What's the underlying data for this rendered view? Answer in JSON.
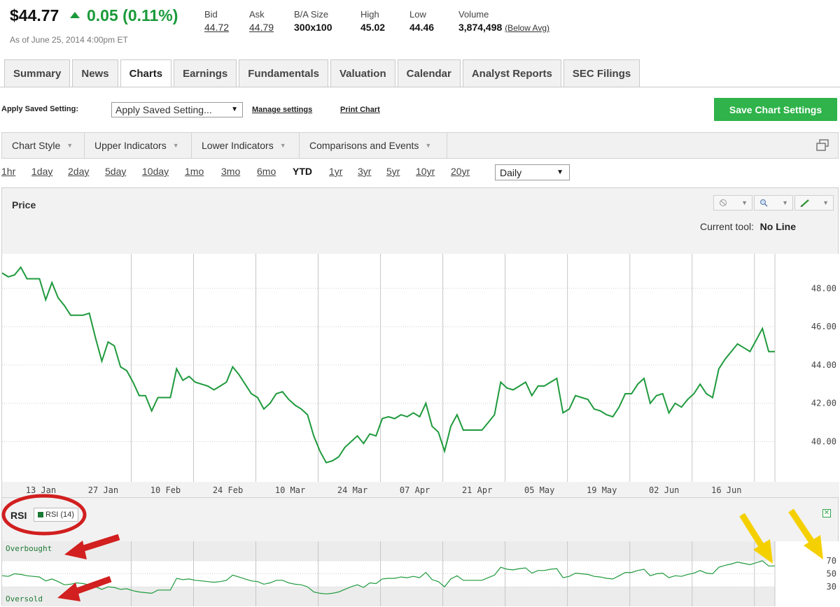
{
  "quote": {
    "price": "$44.77",
    "change": "0.05 (0.11%)",
    "as_of": "As of June 25, 2014 4:00pm ET",
    "stats": [
      {
        "label": "Bid",
        "value": "44.72",
        "style": "link"
      },
      {
        "label": "Ask",
        "value": "44.79",
        "style": "link"
      },
      {
        "label": "B/A Size",
        "value": "300x100",
        "style": "bold"
      },
      {
        "label": "High",
        "value": "45.02",
        "style": "bold"
      },
      {
        "label": "Low",
        "value": "44.46",
        "style": "bold"
      },
      {
        "label": "Volume",
        "value": "3,874,498",
        "style": "bold"
      }
    ],
    "volume_note": "(Below Avg)",
    "up_color": "#1a9a3a"
  },
  "tabs": [
    {
      "label": "Summary",
      "active": false
    },
    {
      "label": "News",
      "active": false
    },
    {
      "label": "Charts",
      "active": true
    },
    {
      "label": "Earnings",
      "active": false
    },
    {
      "label": "Fundamentals",
      "active": false
    },
    {
      "label": "Valuation",
      "active": false
    },
    {
      "label": "Calendar",
      "active": false
    },
    {
      "label": "Analyst Reports",
      "active": false
    },
    {
      "label": "SEC Filings",
      "active": false
    }
  ],
  "settings": {
    "apply_label": "Apply Saved Setting:",
    "apply_value": "Apply Saved Setting...",
    "manage": "Manage settings",
    "print": "Print Chart",
    "save_button": "Save Chart Settings",
    "save_color": "#2fb34a"
  },
  "toolbar": [
    "Chart Style",
    "Upper Indicators",
    "Lower Indicators",
    "Comparisons and Events"
  ],
  "periods": {
    "items": [
      "1hr",
      "1day",
      "2day",
      "5day",
      "10day",
      "1mo",
      "3mo",
      "6mo",
      "YTD",
      "1yr",
      "3yr",
      "5yr",
      "10yr",
      "20yr"
    ],
    "active": "YTD",
    "interval": "Daily"
  },
  "price_panel": {
    "title": "Price",
    "current_tool_label": "Current tool:",
    "current_tool_value": "No Line"
  },
  "rsi_panel": {
    "title": "RSI",
    "legend": "RSI (14)",
    "overbought": "Overbought",
    "oversold": "Oversold"
  },
  "chart_data": [
    {
      "type": "line",
      "title": "Price",
      "x_ticks": [
        "13 Jan",
        "27 Jan",
        "10 Feb",
        "24 Feb",
        "10 Mar",
        "24 Mar",
        "07 Apr",
        "21 Apr",
        "05 May",
        "19 May",
        "02 Jun",
        "16 Jun"
      ],
      "y_ticks": [
        "40.00",
        "42.00",
        "44.00",
        "46.00",
        "48.00"
      ],
      "ylim": [
        37.9,
        49.8
      ],
      "grid": true,
      "line_color": "#1f9a3d",
      "series": [
        {
          "values": [
            48.8,
            48.6,
            48.7,
            49.1,
            48.5,
            48.5,
            48.5,
            47.4,
            48.3,
            47.5,
            47.1,
            46.6,
            46.6,
            46.6,
            46.7,
            45.4,
            44.2,
            45.2,
            45.0,
            43.9,
            43.7,
            43.1,
            42.4,
            42.4,
            41.6,
            42.3,
            42.3,
            42.3,
            43.8,
            43.2,
            43.4,
            43.1,
            43.0,
            42.9,
            42.7,
            42.9,
            43.1,
            43.9,
            43.5,
            43.0,
            42.5,
            42.3,
            41.7,
            42.0,
            42.5,
            42.6,
            42.2,
            41.9,
            41.7,
            41.4,
            40.3,
            39.5,
            38.9,
            39.0,
            39.2,
            39.7,
            40.0,
            40.3,
            39.9,
            40.4,
            40.3,
            41.2,
            41.3,
            41.2,
            41.4,
            41.3,
            41.5,
            41.3,
            42.0,
            40.8,
            40.5,
            39.5,
            40.8,
            41.4,
            40.6,
            40.6,
            40.6,
            40.6,
            41.0,
            41.4,
            43.1,
            42.8,
            42.7,
            42.9,
            43.1,
            42.4,
            42.9,
            42.9,
            43.1,
            43.3,
            41.5,
            41.7,
            42.4,
            42.3,
            42.2,
            41.7,
            41.6,
            41.4,
            41.3,
            41.8,
            42.5,
            42.5,
            43.0,
            43.3,
            42.0,
            42.4,
            42.5,
            41.5,
            42.0,
            41.8,
            42.2,
            42.5,
            43.0,
            42.5,
            42.3,
            43.8,
            44.3,
            44.7,
            45.1,
            44.9,
            44.7,
            45.3,
            45.9,
            44.7,
            44.7
          ]
        }
      ]
    },
    {
      "type": "line",
      "title": "RSI",
      "y_ticks": [
        "30",
        "50",
        "70"
      ],
      "ylim": [
        0,
        100
      ],
      "grid": true,
      "line_color": "#1f9a3d",
      "series": [
        {
          "name": "RSI (14)",
          "values": [
            47,
            46,
            50,
            49,
            47,
            46,
            45,
            39,
            42,
            38,
            33,
            34,
            36,
            35,
            33,
            30,
            26,
            30,
            29,
            26,
            27,
            24,
            22,
            21,
            20,
            25,
            25,
            25,
            43,
            41,
            42,
            40,
            39,
            38,
            37,
            38,
            40,
            48,
            45,
            42,
            39,
            38,
            34,
            36,
            40,
            40,
            36,
            34,
            33,
            30,
            22,
            20,
            19,
            20,
            22,
            26,
            30,
            33,
            29,
            36,
            35,
            42,
            43,
            43,
            45,
            44,
            46,
            44,
            52,
            41,
            38,
            30,
            42,
            47,
            40,
            40,
            40,
            40,
            44,
            48,
            60,
            57,
            56,
            58,
            59,
            51,
            55,
            55,
            57,
            58,
            44,
            46,
            51,
            50,
            49,
            46,
            45,
            43,
            42,
            47,
            52,
            52,
            55,
            57,
            47,
            50,
            51,
            44,
            47,
            46,
            49,
            51,
            55,
            51,
            50,
            60,
            63,
            65,
            68,
            66,
            64,
            67,
            70,
            62,
            62
          ]
        }
      ]
    }
  ],
  "annotations": {
    "red_color": "#d21f1f",
    "yellow_color": "#f5d000"
  }
}
